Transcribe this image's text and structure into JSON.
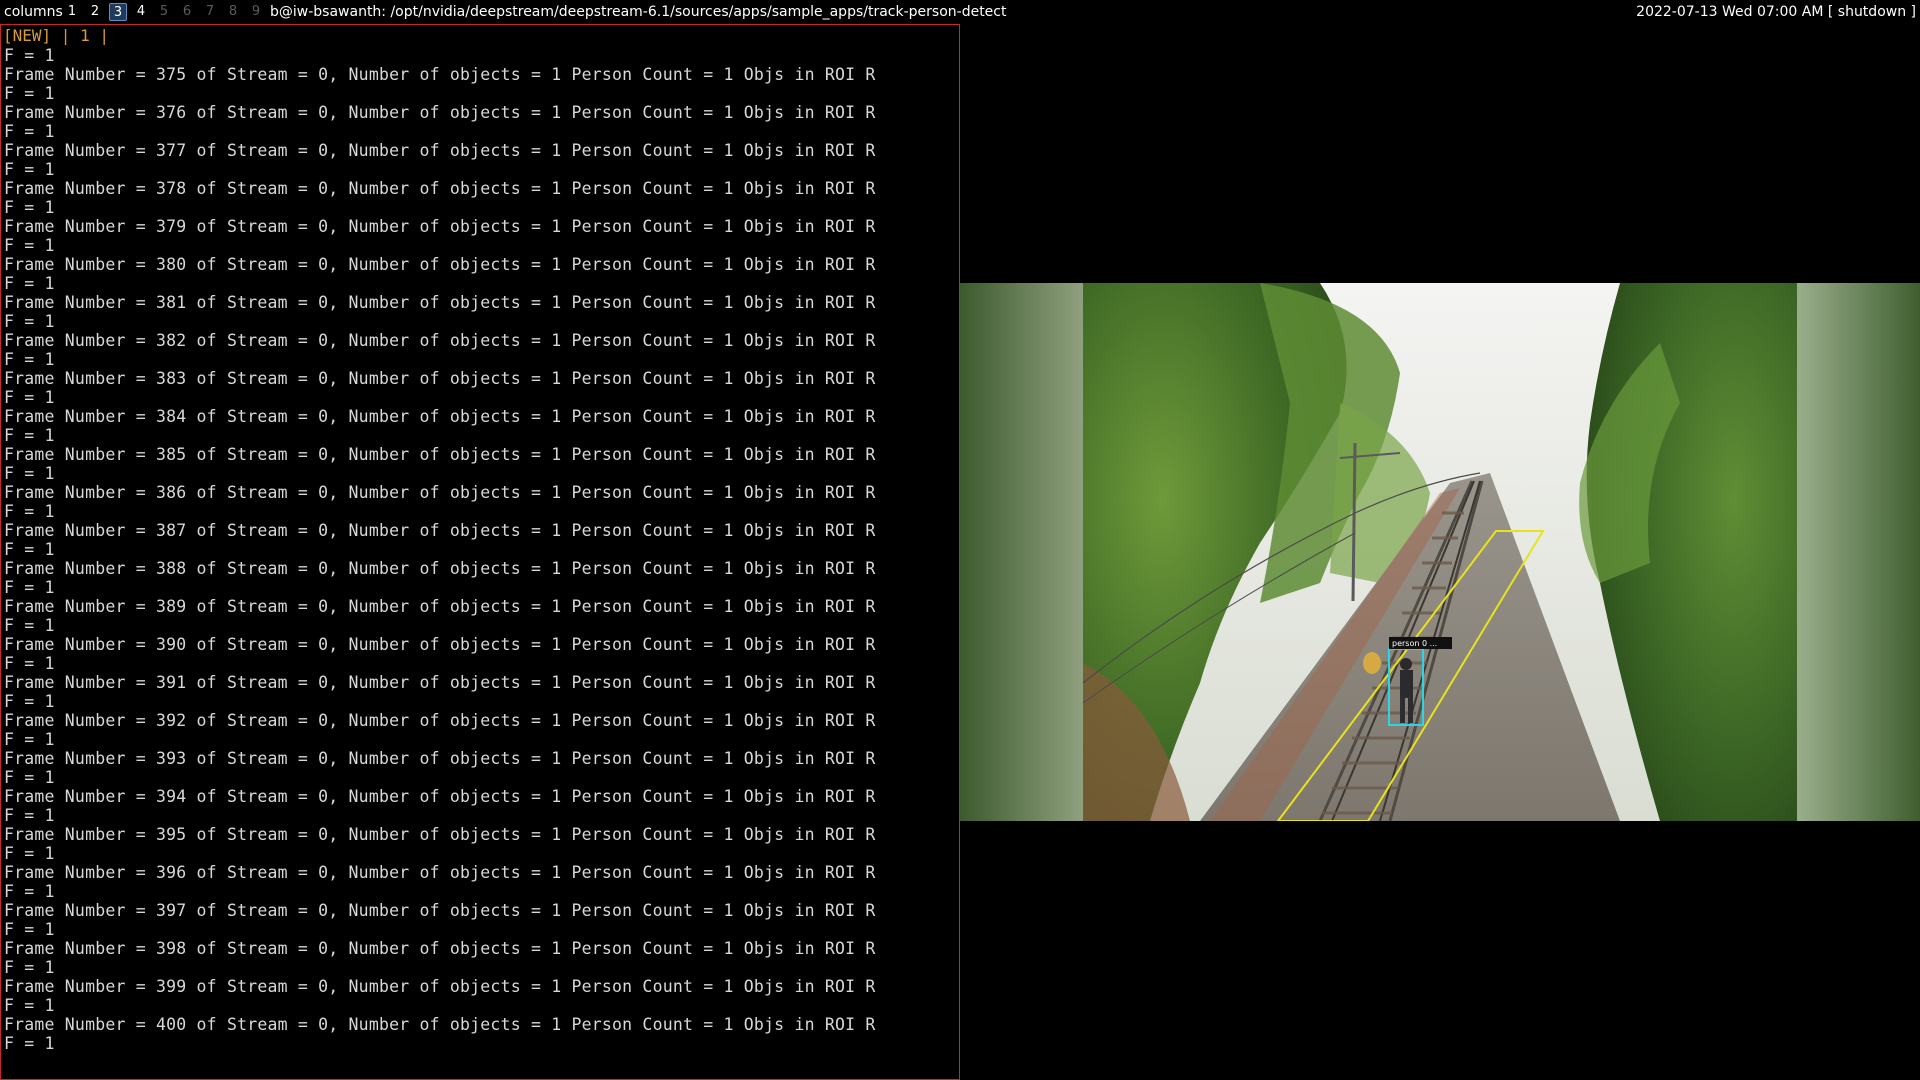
{
  "topbar": {
    "layout_label": "columns",
    "workspaces": [
      {
        "label": "1",
        "state": "occupied"
      },
      {
        "label": "2",
        "state": "occupied"
      },
      {
        "label": "3",
        "state": "active"
      },
      {
        "label": "4",
        "state": "occupied"
      },
      {
        "label": "5",
        "state": "empty"
      },
      {
        "label": "6",
        "state": "empty"
      },
      {
        "label": "7",
        "state": "empty"
      },
      {
        "label": "8",
        "state": "empty"
      },
      {
        "label": "9",
        "state": "empty"
      }
    ],
    "window_title": "b@iw-bsawanth: /opt/nvidia/deepstream/deepstream-6.1/sources/apps/sample_apps/track-person-detect",
    "datetime": "2022-07-13 Wed 07:00 AM",
    "shutdown_label": "[ shutdown ]"
  },
  "terminal": {
    "tmux_status": "[NEW] | 1 |",
    "lines": [
      "F = 1",
      "Frame Number = 375 of Stream = 0, Number of objects = 1 Person Count = 1 Objs in ROI R",
      "F = 1",
      "Frame Number = 376 of Stream = 0, Number of objects = 1 Person Count = 1 Objs in ROI R",
      "F = 1",
      "Frame Number = 377 of Stream = 0, Number of objects = 1 Person Count = 1 Objs in ROI R",
      "F = 1",
      "Frame Number = 378 of Stream = 0, Number of objects = 1 Person Count = 1 Objs in ROI R",
      "F = 1",
      "Frame Number = 379 of Stream = 0, Number of objects = 1 Person Count = 1 Objs in ROI R",
      "F = 1",
      "Frame Number = 380 of Stream = 0, Number of objects = 1 Person Count = 1 Objs in ROI R",
      "F = 1",
      "Frame Number = 381 of Stream = 0, Number of objects = 1 Person Count = 1 Objs in ROI R",
      "F = 1",
      "Frame Number = 382 of Stream = 0, Number of objects = 1 Person Count = 1 Objs in ROI R",
      "F = 1",
      "Frame Number = 383 of Stream = 0, Number of objects = 1 Person Count = 1 Objs in ROI R",
      "F = 1",
      "Frame Number = 384 of Stream = 0, Number of objects = 1 Person Count = 1 Objs in ROI R",
      "F = 1",
      "Frame Number = 385 of Stream = 0, Number of objects = 1 Person Count = 1 Objs in ROI R",
      "F = 1",
      "Frame Number = 386 of Stream = 0, Number of objects = 1 Person Count = 1 Objs in ROI R",
      "F = 1",
      "Frame Number = 387 of Stream = 0, Number of objects = 1 Person Count = 1 Objs in ROI R",
      "F = 1",
      "Frame Number = 388 of Stream = 0, Number of objects = 1 Person Count = 1 Objs in ROI R",
      "F = 1",
      "Frame Number = 389 of Stream = 0, Number of objects = 1 Person Count = 1 Objs in ROI R",
      "F = 1",
      "Frame Number = 390 of Stream = 0, Number of objects = 1 Person Count = 1 Objs in ROI R",
      "F = 1",
      "Frame Number = 391 of Stream = 0, Number of objects = 1 Person Count = 1 Objs in ROI R",
      "F = 1",
      "Frame Number = 392 of Stream = 0, Number of objects = 1 Person Count = 1 Objs in ROI R",
      "F = 1",
      "Frame Number = 393 of Stream = 0, Number of objects = 1 Person Count = 1 Objs in ROI R",
      "F = 1",
      "Frame Number = 394 of Stream = 0, Number of objects = 1 Person Count = 1 Objs in ROI R",
      "F = 1",
      "Frame Number = 395 of Stream = 0, Number of objects = 1 Person Count = 1 Objs in ROI R",
      "F = 1",
      "Frame Number = 396 of Stream = 0, Number of objects = 1 Person Count = 1 Objs in ROI R",
      "F = 1",
      "Frame Number = 397 of Stream = 0, Number of objects = 1 Person Count = 1 Objs in ROI R",
      "F = 1",
      "Frame Number = 398 of Stream = 0, Number of objects = 1 Person Count = 1 Objs in ROI R",
      "F = 1",
      "Frame Number = 399 of Stream = 0, Number of objects = 1 Person Count = 1 Objs in ROI R",
      "F = 1",
      "Frame Number = 400 of Stream = 0, Number of objects = 1 Person Count = 1 Objs in ROI R",
      "F = 1"
    ]
  },
  "video": {
    "detection_label": "person 0 ...",
    "colors": {
      "roi": "#e8e21e",
      "bbox": "#2fd3e6",
      "label_bg": "#111111",
      "terminal_border": "#c42a2a",
      "tmux_status": "#d79a3a"
    }
  }
}
